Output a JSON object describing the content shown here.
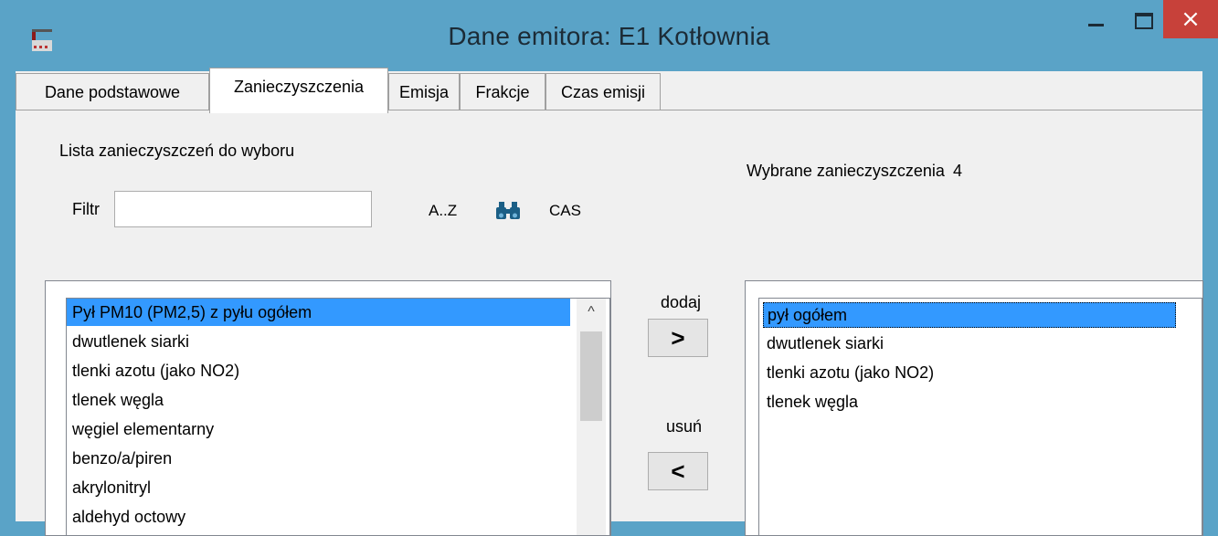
{
  "window": {
    "title": "Dane emitora: E1 Kotłownia",
    "close_glyph": "×"
  },
  "tabs": [
    {
      "label": "Dane podstawowe"
    },
    {
      "label": "Zanieczyszczenia",
      "active": true
    },
    {
      "label": "Emisja"
    },
    {
      "label": "Frakcje"
    },
    {
      "label": "Czas emisji"
    }
  ],
  "left": {
    "heading": "Lista zanieczyszczeń do wyboru",
    "filter_label": "Filtr",
    "filter_value": "",
    "sort_az_label": "A..Z",
    "search_icon": "binoculars-icon",
    "sort_cas_label": "CAS",
    "items": [
      "Pył PM10 (PM2,5) z pyłu ogółem",
      "dwutlenek siarki",
      "tlenki azotu (jako NO2)",
      "tlenek węgla",
      "węgiel elementarny",
      "benzo/a/piren",
      "akrylonitryl",
      "aldehyd octowy"
    ],
    "selected_index": 0,
    "scroll_up_glyph": "^"
  },
  "middle": {
    "add_label": "dodaj",
    "add_button": ">",
    "remove_label": "usuń",
    "remove_button": "<"
  },
  "right": {
    "heading": "Wybrane zanieczyszczenia",
    "count": "4",
    "items": [
      "pył ogółem",
      "dwutlenek siarki",
      "tlenki azotu (jako NO2)",
      "tlenek węgla"
    ],
    "selected_index": 0
  },
  "colors": {
    "title_bar": "#5aa3c7",
    "close_button": "#c7413a",
    "selection": "#3399ff"
  }
}
